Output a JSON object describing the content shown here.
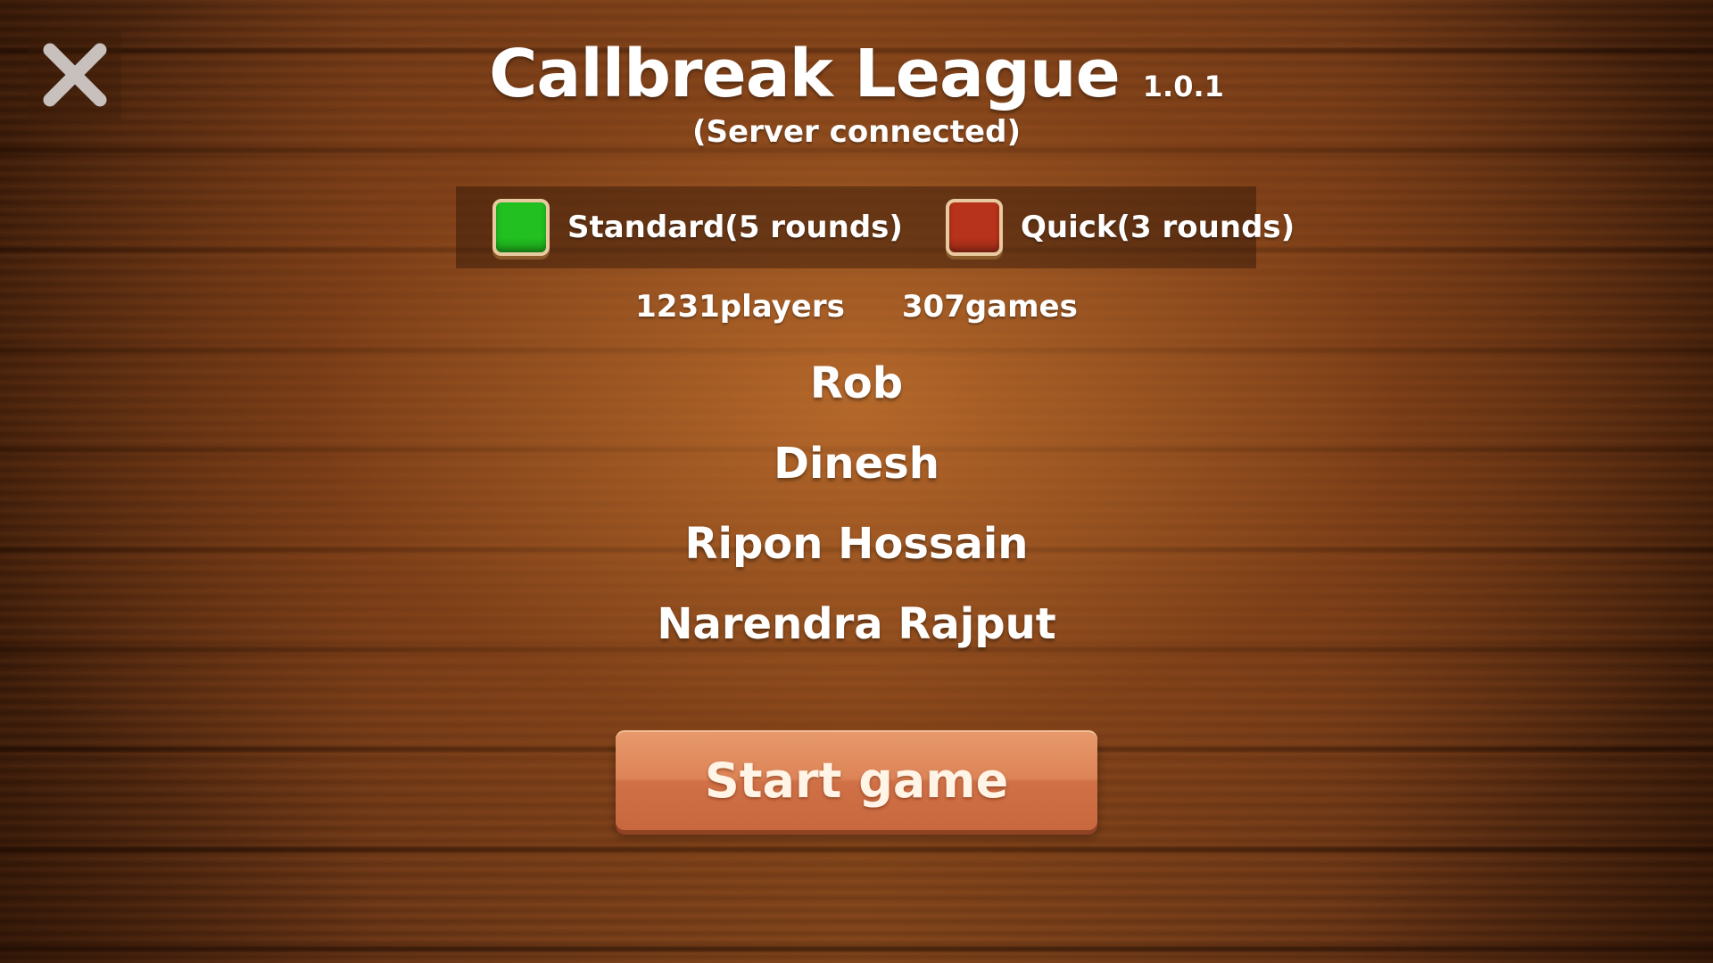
{
  "header": {
    "title": "Callbreak League",
    "version": "1.0.1",
    "status": "(Server connected)"
  },
  "close_icon": "close-icon",
  "modes": [
    {
      "label": "Standard(5 rounds)",
      "color": "#22c020",
      "selected": true
    },
    {
      "label": "Quick(3 rounds)",
      "color": "#b8331b",
      "selected": false
    }
  ],
  "stats": {
    "players": "1231players",
    "games": "307games"
  },
  "players": [
    {
      "name": "Rob"
    },
    {
      "name": "Dinesh"
    },
    {
      "name": "Ripon Hossain"
    },
    {
      "name": "Narendra Rajput"
    }
  ],
  "start_button": {
    "label": "Start game",
    "color": "#dd8458"
  }
}
